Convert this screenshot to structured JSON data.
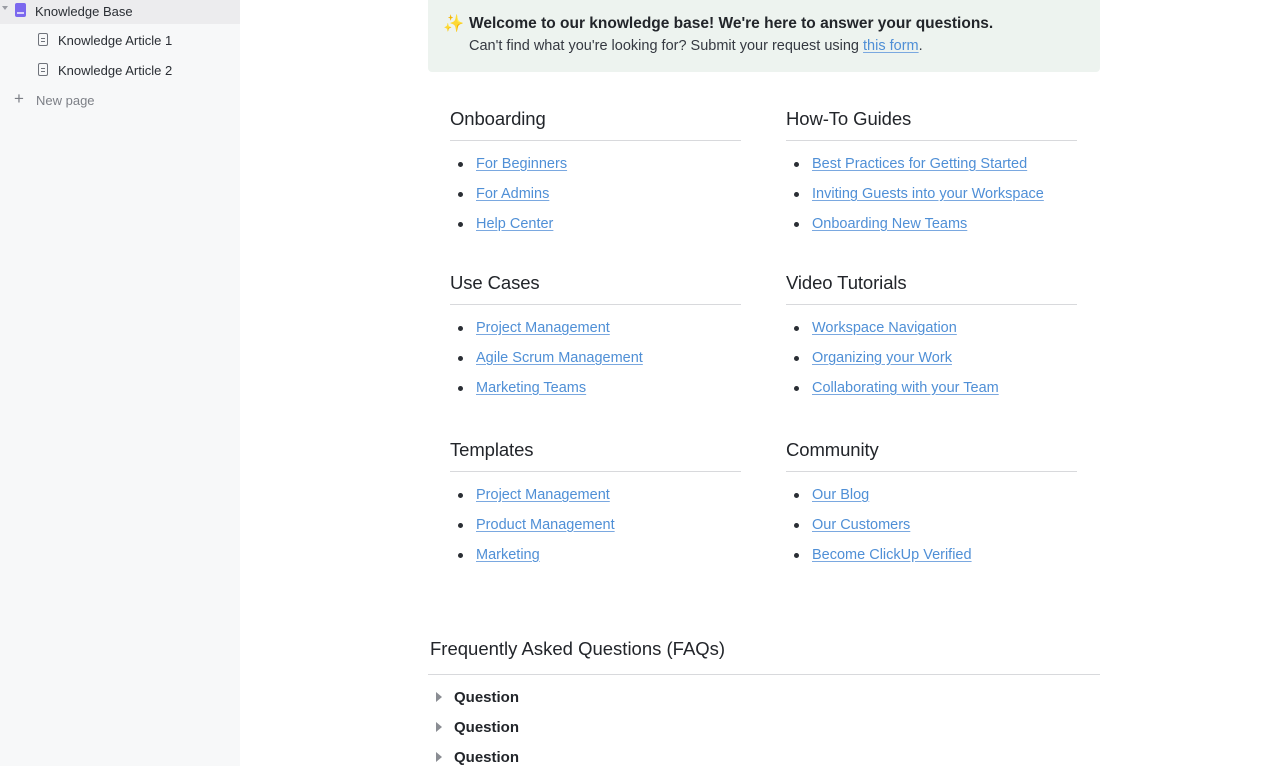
{
  "sidebar": {
    "items": [
      {
        "label": "Knowledge Base",
        "icon": "book-icon",
        "active": true
      },
      {
        "label": "Knowledge Article 1",
        "icon": "document-icon"
      },
      {
        "label": "Knowledge Article 2",
        "icon": "document-icon"
      }
    ],
    "new_page_label": "New page"
  },
  "banner": {
    "icon": "sparkles-icon",
    "title": "Welcome to our knowledge base! We're here to answer your questions.",
    "subtitle_prefix": "Can't find what you're looking for? Submit your request using ",
    "link_text": "this form",
    "subtitle_suffix": "."
  },
  "sections": [
    {
      "title": "Onboarding",
      "links": [
        "For Beginners",
        "For Admins",
        "Help Center"
      ]
    },
    {
      "title": "How-To Guides",
      "links": [
        "Best Practices for Getting Started",
        "Inviting Guests into your Workspace",
        "Onboarding New Teams"
      ]
    },
    {
      "title": "Use Cases",
      "links": [
        "Project Management",
        "Agile Scrum Management",
        "Marketing Teams"
      ]
    },
    {
      "title": "Video Tutorials",
      "links": [
        "Workspace Navigation",
        "Organizing your Work",
        "Collaborating with your Team"
      ]
    },
    {
      "title": "Templates",
      "links": [
        "Project Management",
        "Product Management",
        "Marketing"
      ]
    },
    {
      "title": "Community",
      "links": [
        "Our Blog",
        "Our Customers",
        "Become ClickUp Verified"
      ]
    }
  ],
  "faq": {
    "title": "Frequently Asked Questions (FAQs)",
    "questions": [
      "Question",
      "Question",
      "Question"
    ]
  },
  "colors": {
    "link": "#4f8fd6",
    "banner_bg": "#edf3ef",
    "accent": "#7b68ee"
  }
}
